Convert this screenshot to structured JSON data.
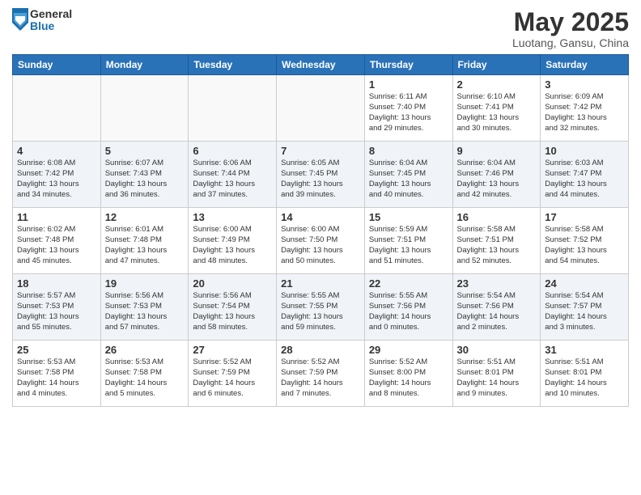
{
  "logo": {
    "general": "General",
    "blue": "Blue"
  },
  "title": "May 2025",
  "subtitle": "Luotang, Gansu, China",
  "days": [
    "Sunday",
    "Monday",
    "Tuesday",
    "Wednesday",
    "Thursday",
    "Friday",
    "Saturday"
  ],
  "weeks": [
    [
      {
        "num": "",
        "info": ""
      },
      {
        "num": "",
        "info": ""
      },
      {
        "num": "",
        "info": ""
      },
      {
        "num": "",
        "info": ""
      },
      {
        "num": "1",
        "info": "Sunrise: 6:11 AM\nSunset: 7:40 PM\nDaylight: 13 hours\nand 29 minutes."
      },
      {
        "num": "2",
        "info": "Sunrise: 6:10 AM\nSunset: 7:41 PM\nDaylight: 13 hours\nand 30 minutes."
      },
      {
        "num": "3",
        "info": "Sunrise: 6:09 AM\nSunset: 7:42 PM\nDaylight: 13 hours\nand 32 minutes."
      }
    ],
    [
      {
        "num": "4",
        "info": "Sunrise: 6:08 AM\nSunset: 7:42 PM\nDaylight: 13 hours\nand 34 minutes."
      },
      {
        "num": "5",
        "info": "Sunrise: 6:07 AM\nSunset: 7:43 PM\nDaylight: 13 hours\nand 36 minutes."
      },
      {
        "num": "6",
        "info": "Sunrise: 6:06 AM\nSunset: 7:44 PM\nDaylight: 13 hours\nand 37 minutes."
      },
      {
        "num": "7",
        "info": "Sunrise: 6:05 AM\nSunset: 7:45 PM\nDaylight: 13 hours\nand 39 minutes."
      },
      {
        "num": "8",
        "info": "Sunrise: 6:04 AM\nSunset: 7:45 PM\nDaylight: 13 hours\nand 40 minutes."
      },
      {
        "num": "9",
        "info": "Sunrise: 6:04 AM\nSunset: 7:46 PM\nDaylight: 13 hours\nand 42 minutes."
      },
      {
        "num": "10",
        "info": "Sunrise: 6:03 AM\nSunset: 7:47 PM\nDaylight: 13 hours\nand 44 minutes."
      }
    ],
    [
      {
        "num": "11",
        "info": "Sunrise: 6:02 AM\nSunset: 7:48 PM\nDaylight: 13 hours\nand 45 minutes."
      },
      {
        "num": "12",
        "info": "Sunrise: 6:01 AM\nSunset: 7:48 PM\nDaylight: 13 hours\nand 47 minutes."
      },
      {
        "num": "13",
        "info": "Sunrise: 6:00 AM\nSunset: 7:49 PM\nDaylight: 13 hours\nand 48 minutes."
      },
      {
        "num": "14",
        "info": "Sunrise: 6:00 AM\nSunset: 7:50 PM\nDaylight: 13 hours\nand 50 minutes."
      },
      {
        "num": "15",
        "info": "Sunrise: 5:59 AM\nSunset: 7:51 PM\nDaylight: 13 hours\nand 51 minutes."
      },
      {
        "num": "16",
        "info": "Sunrise: 5:58 AM\nSunset: 7:51 PM\nDaylight: 13 hours\nand 52 minutes."
      },
      {
        "num": "17",
        "info": "Sunrise: 5:58 AM\nSunset: 7:52 PM\nDaylight: 13 hours\nand 54 minutes."
      }
    ],
    [
      {
        "num": "18",
        "info": "Sunrise: 5:57 AM\nSunset: 7:53 PM\nDaylight: 13 hours\nand 55 minutes."
      },
      {
        "num": "19",
        "info": "Sunrise: 5:56 AM\nSunset: 7:53 PM\nDaylight: 13 hours\nand 57 minutes."
      },
      {
        "num": "20",
        "info": "Sunrise: 5:56 AM\nSunset: 7:54 PM\nDaylight: 13 hours\nand 58 minutes."
      },
      {
        "num": "21",
        "info": "Sunrise: 5:55 AM\nSunset: 7:55 PM\nDaylight: 13 hours\nand 59 minutes."
      },
      {
        "num": "22",
        "info": "Sunrise: 5:55 AM\nSunset: 7:56 PM\nDaylight: 14 hours\nand 0 minutes."
      },
      {
        "num": "23",
        "info": "Sunrise: 5:54 AM\nSunset: 7:56 PM\nDaylight: 14 hours\nand 2 minutes."
      },
      {
        "num": "24",
        "info": "Sunrise: 5:54 AM\nSunset: 7:57 PM\nDaylight: 14 hours\nand 3 minutes."
      }
    ],
    [
      {
        "num": "25",
        "info": "Sunrise: 5:53 AM\nSunset: 7:58 PM\nDaylight: 14 hours\nand 4 minutes."
      },
      {
        "num": "26",
        "info": "Sunrise: 5:53 AM\nSunset: 7:58 PM\nDaylight: 14 hours\nand 5 minutes."
      },
      {
        "num": "27",
        "info": "Sunrise: 5:52 AM\nSunset: 7:59 PM\nDaylight: 14 hours\nand 6 minutes."
      },
      {
        "num": "28",
        "info": "Sunrise: 5:52 AM\nSunset: 7:59 PM\nDaylight: 14 hours\nand 7 minutes."
      },
      {
        "num": "29",
        "info": "Sunrise: 5:52 AM\nSunset: 8:00 PM\nDaylight: 14 hours\nand 8 minutes."
      },
      {
        "num": "30",
        "info": "Sunrise: 5:51 AM\nSunset: 8:01 PM\nDaylight: 14 hours\nand 9 minutes."
      },
      {
        "num": "31",
        "info": "Sunrise: 5:51 AM\nSunset: 8:01 PM\nDaylight: 14 hours\nand 10 minutes."
      }
    ]
  ]
}
